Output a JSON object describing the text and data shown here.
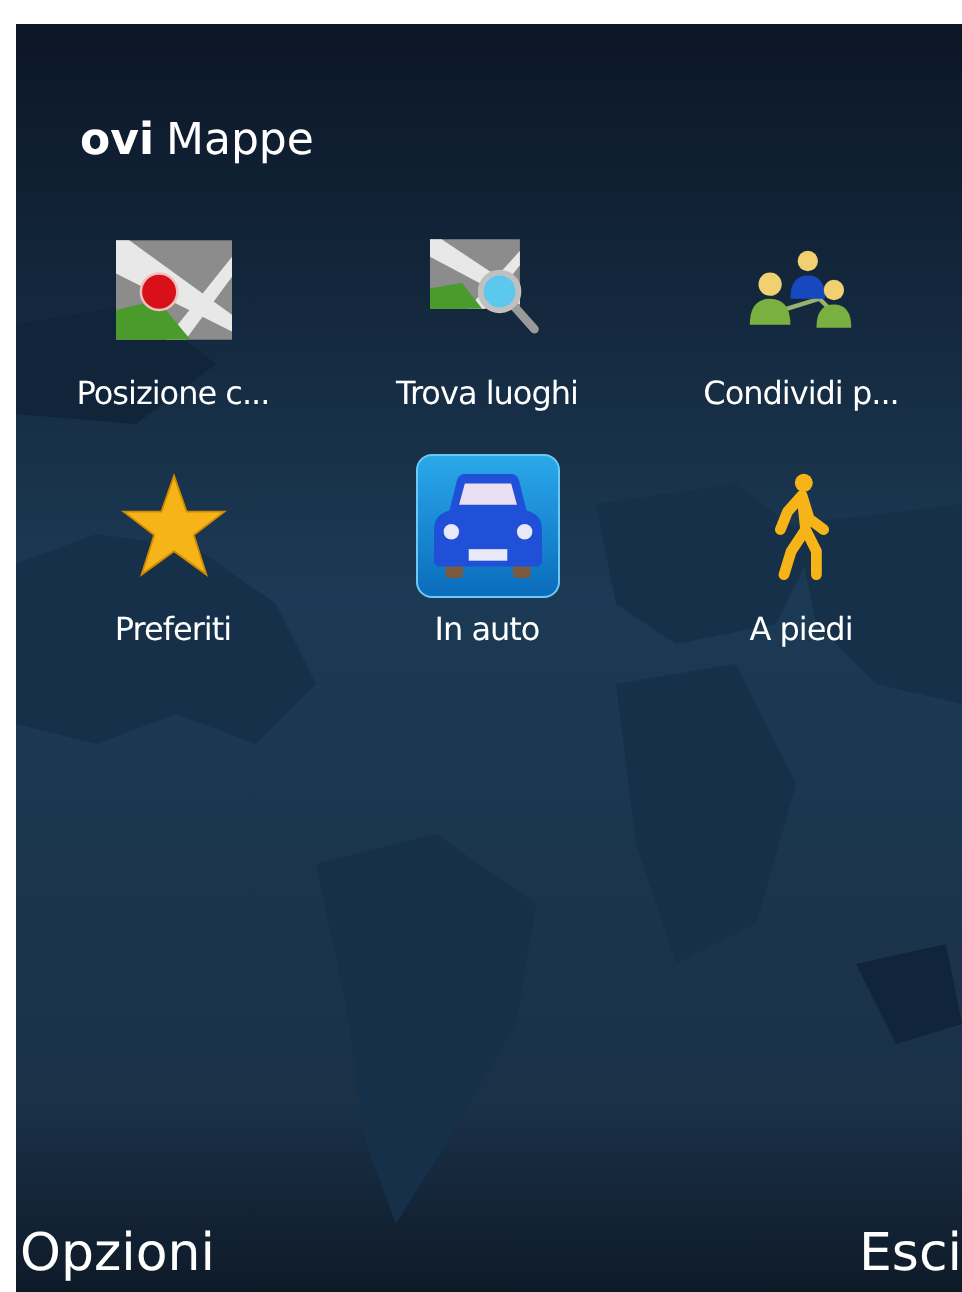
{
  "title": {
    "brand": "ovi",
    "name": "Mappe"
  },
  "items": [
    {
      "label": "Posizione c...",
      "kind": "location",
      "selected": false
    },
    {
      "label": "Trova luoghi",
      "kind": "search",
      "selected": false
    },
    {
      "label": "Condividi p...",
      "kind": "share",
      "selected": false
    },
    {
      "label": "Preferiti",
      "kind": "favorite",
      "selected": false
    },
    {
      "label": "In auto",
      "kind": "car",
      "selected": true
    },
    {
      "label": "A piedi",
      "kind": "walk",
      "selected": false
    }
  ],
  "softkeys": {
    "left": "Opzioni",
    "right": "Esci"
  }
}
